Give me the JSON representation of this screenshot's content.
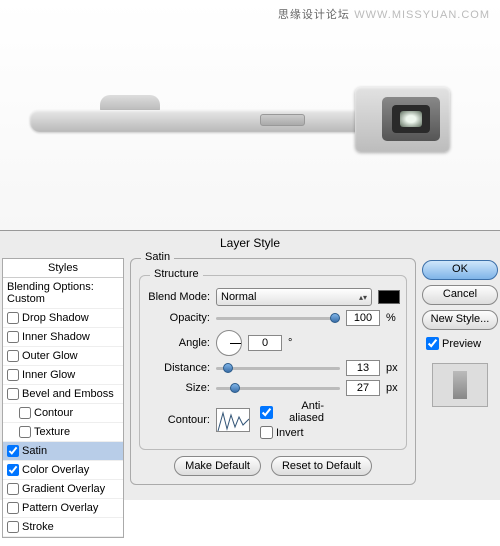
{
  "watermark": {
    "left": "思缘设计论坛",
    "right": "WWW.MISSYUAN.COM"
  },
  "dialog": {
    "title": "Layer Style",
    "styles_header": "Styles",
    "blending_label": "Blending Options: Custom",
    "effects": [
      {
        "label": "Drop Shadow",
        "checked": false
      },
      {
        "label": "Inner Shadow",
        "checked": false
      },
      {
        "label": "Outer Glow",
        "checked": false
      },
      {
        "label": "Inner Glow",
        "checked": false
      },
      {
        "label": "Bevel and Emboss",
        "checked": false
      },
      {
        "label": "Contour",
        "checked": false,
        "indent": true
      },
      {
        "label": "Texture",
        "checked": false,
        "indent": true
      },
      {
        "label": "Satin",
        "checked": true,
        "selected": true
      },
      {
        "label": "Color Overlay",
        "checked": true
      },
      {
        "label": "Gradient Overlay",
        "checked": false
      },
      {
        "label": "Pattern Overlay",
        "checked": false
      },
      {
        "label": "Stroke",
        "checked": false
      }
    ],
    "satin": {
      "group_label": "Satin",
      "structure_label": "Structure",
      "blend_mode_label": "Blend Mode:",
      "blend_mode_value": "Normal",
      "opacity_label": "Opacity:",
      "opacity_value": "100",
      "opacity_unit": "%",
      "angle_label": "Angle:",
      "angle_value": "0",
      "angle_unit": "°",
      "distance_label": "Distance:",
      "distance_value": "13",
      "distance_unit": "px",
      "size_label": "Size:",
      "size_value": "27",
      "size_unit": "px",
      "contour_label": "Contour:",
      "anti_aliased_label": "Anti-aliased",
      "invert_label": "Invert",
      "make_default": "Make Default",
      "reset_default": "Reset to Default"
    },
    "buttons": {
      "ok": "OK",
      "cancel": "Cancel",
      "new_style": "New Style...",
      "preview": "Preview"
    }
  }
}
